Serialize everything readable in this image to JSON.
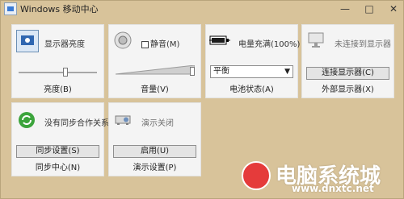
{
  "window": {
    "title": "Windows 移动中心"
  },
  "tiles": {
    "display": {
      "label": "显示器亮度",
      "caption": "亮度(B)",
      "level": 0.5
    },
    "volume": {
      "mute_label": "静音(M)",
      "caption": "音量(V)",
      "level": 0.95
    },
    "battery": {
      "label": "电量充满(100%)",
      "plan_value": "平衡",
      "caption": "电池状态(A)"
    },
    "external_display": {
      "label": "未连接到显示器",
      "button": "连接显示器(C)",
      "caption": "外部显示器(X)"
    },
    "sync": {
      "label": "没有同步合作关系",
      "button": "同步设置(S)",
      "caption": "同步中心(N)"
    },
    "presentation": {
      "label": "演示关闭",
      "button": "启用(U)",
      "caption": "演示设置(P)"
    }
  },
  "watermark": {
    "brand": "电脑系统城",
    "url": "www.dnxtc.net"
  },
  "icons": {
    "app": "mobility-center-icon",
    "display": "display-icon",
    "volume": "speaker-icon",
    "battery": "battery-icon",
    "external_display": "monitor-icon",
    "sync": "sync-icon",
    "presentation": "projector-icon"
  }
}
